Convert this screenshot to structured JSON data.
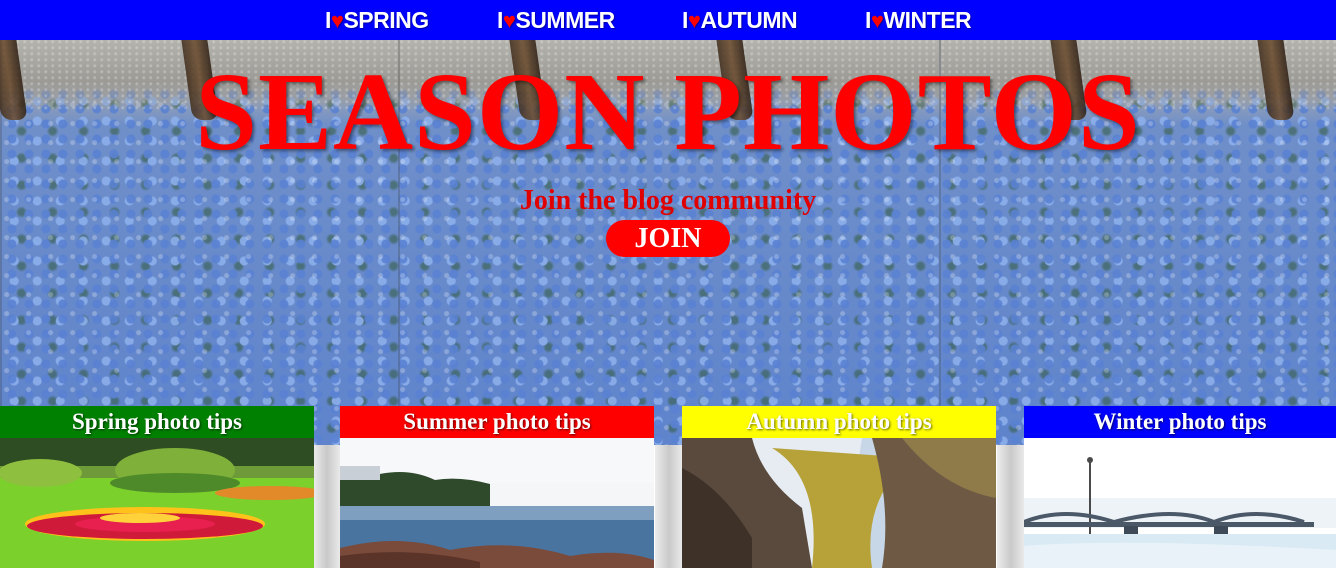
{
  "nav": {
    "items": [
      {
        "prefix": "I",
        "heart": "♥",
        "label": "SPRING"
      },
      {
        "prefix": "I",
        "heart": "♥",
        "label": "SUMMER"
      },
      {
        "prefix": "I",
        "heart": "♥",
        "label": "AUTUMN"
      },
      {
        "prefix": "I",
        "heart": "♥",
        "label": "WINTER"
      }
    ]
  },
  "hero": {
    "title": "SEASON PHOTOS",
    "subtitle": "Join the blog community",
    "join_label": "JOIN"
  },
  "cards": [
    {
      "title": "Spring photo tips",
      "color": "#008000"
    },
    {
      "title": "Summer photo tips",
      "color": "#ff0000"
    },
    {
      "title": "Autumn photo tips",
      "color": "#ffff00"
    },
    {
      "title": "Winter photo tips",
      "color": "#0000ff"
    }
  ],
  "colors": {
    "nav_bg": "#0000ff",
    "accent_red": "#ff0000",
    "heart": "#ff0000"
  }
}
